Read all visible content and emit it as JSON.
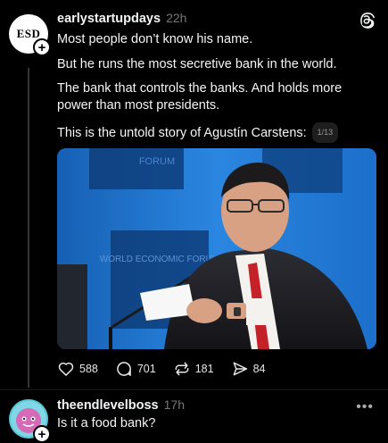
{
  "post": {
    "avatar_text": "ESD",
    "username": "earlystartupdays",
    "time": "22h",
    "paragraphs": [
      "Most people don’t know his name.",
      "But he runs the most secretive bank in the world.",
      "The bank that controls the banks. And holds more power than most presidents.",
      "This is the untold story of Agustín Carstens:"
    ],
    "page_badge": "1/13",
    "media_backdrop_text": [
      "FORUM",
      "WORLD ECONOMIC FORUM"
    ],
    "actions": {
      "likes": "588",
      "replies": "701",
      "reposts": "181",
      "shares": "84"
    }
  },
  "reply": {
    "username": "theendlevelboss",
    "time": "17h",
    "text": "Is it a food bank?"
  },
  "colors": {
    "background": "#000000",
    "text": "#f3f5f7",
    "muted": "#777777",
    "media_blue": "#1d6fc7"
  },
  "icons": [
    "threads-logo-icon",
    "heart-icon",
    "comment-icon",
    "repost-icon",
    "share-icon",
    "follow-plus-icon",
    "more-icon"
  ]
}
